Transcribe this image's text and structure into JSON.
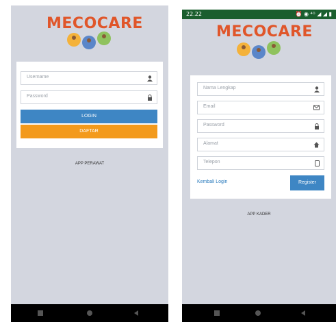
{
  "brand": {
    "name": "MECOCARE",
    "name_color": "#e0562a"
  },
  "left_screen": {
    "fields": [
      {
        "placeholder": "Username",
        "icon": "user-icon"
      },
      {
        "placeholder": "Password",
        "icon": "lock-icon"
      }
    ],
    "login_label": "LOGIN",
    "register_label": "DAFTAR",
    "footer": "APP PERAWAT"
  },
  "right_screen": {
    "status": {
      "time": "22.22",
      "icons_right": "⏰ ◉ ⁴ᴳ ◢ ◢ ▮"
    },
    "fields": [
      {
        "placeholder": "Nama Lengkap",
        "icon": "user-icon"
      },
      {
        "placeholder": "Email",
        "icon": "envelope-icon"
      },
      {
        "placeholder": "Password",
        "icon": "lock-icon"
      },
      {
        "placeholder": "Alamat",
        "icon": "home-icon"
      },
      {
        "placeholder": "Telepon",
        "icon": "phone-icon"
      }
    ],
    "back_link": "Kembali Login",
    "register_label": "Register",
    "footer": "APP KADER"
  },
  "colors": {
    "background": "#d3d6df",
    "blue": "#3e86c4",
    "orange": "#f39a1c",
    "statusbar": "#1a5e2e"
  }
}
